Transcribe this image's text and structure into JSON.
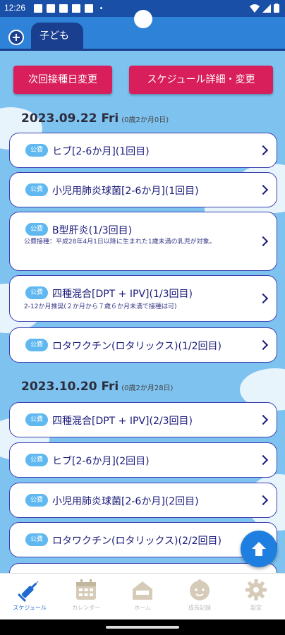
{
  "status": {
    "time": "12:26"
  },
  "tabbar": {
    "tab_label": "子ども",
    "add_symbol": "+"
  },
  "actions": {
    "change_date": "次回接種日変更",
    "schedule_detail": "スケジュール詳細・変更"
  },
  "groups": [
    {
      "date": "2023.09.22 Fri",
      "age": "(0歳2か月0日)",
      "items": [
        {
          "badge": "公費",
          "title": "ヒブ[2-6か月](1回目)",
          "desc": ""
        },
        {
          "badge": "公費",
          "title": "小児用肺炎球菌[2-6か月](1回目)",
          "desc": ""
        },
        {
          "badge": "公費",
          "title": "B型肝炎(1/3回目)",
          "desc": "公費接種：平成28年4月1日以降に生まれた1歳未満の乳児が対象。"
        },
        {
          "badge": "公費",
          "title": "四種混合[DPT + IPV](1/3回目)",
          "desc": "2-12か月推奨(２か月から７歳６か月未満で接種は可)"
        },
        {
          "badge": "公費",
          "title": "ロタワクチン(ロタリックス)(1/2回目)",
          "desc": ""
        }
      ]
    },
    {
      "date": "2023.10.20 Fri",
      "age": "(0歳2か月28日)",
      "items": [
        {
          "badge": "公費",
          "title": "四種混合[DPT + IPV](2/3回目)",
          "desc": ""
        },
        {
          "badge": "公費",
          "title": "ヒブ[2-6か月](2回目)",
          "desc": ""
        },
        {
          "badge": "公費",
          "title": "小児用肺炎球菌[2-6か月](2回目)",
          "desc": ""
        },
        {
          "badge": "公費",
          "title": "ロタワクチン(ロタリックス)(2/2回目)",
          "desc": ""
        }
      ]
    }
  ],
  "nav": [
    {
      "label": "スケジュール",
      "icon": "syringe-icon",
      "active": true
    },
    {
      "label": "カレンダー",
      "icon": "calendar-icon",
      "active": false
    },
    {
      "label": "ホーム",
      "icon": "home-icon",
      "active": false
    },
    {
      "label": "成長記録",
      "icon": "baby-face-icon",
      "active": false
    },
    {
      "label": "設定",
      "icon": "gear-icon",
      "active": false
    }
  ],
  "colors": {
    "accent": "#d81e5b",
    "primary": "#1a3f8f",
    "background": "#7ec2f0",
    "badge": "#5fb8f0"
  }
}
